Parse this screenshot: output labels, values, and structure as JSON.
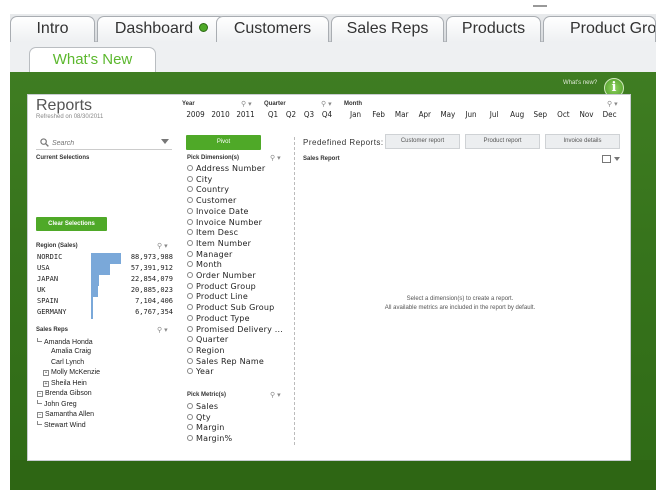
{
  "tabs": [
    {
      "label": "Intro"
    },
    {
      "label": "Dashboard"
    },
    {
      "label": "Customers"
    },
    {
      "label": "Sales Reps"
    },
    {
      "label": "Products"
    },
    {
      "label": "Product Grou"
    }
  ],
  "subtab": {
    "label": "What's New"
  },
  "help": {
    "whats_new_label": "What's new?",
    "info_glyph": "i"
  },
  "reports": {
    "title": "Reports",
    "refreshed": "Refreshed on 08/30/2011"
  },
  "filters": {
    "year_label": "Year",
    "years": [
      "2009",
      "2010",
      "2011"
    ],
    "quarter_label": "Quarter",
    "quarters": [
      "Q1",
      "Q2",
      "Q3",
      "Q4"
    ],
    "month_label": "Month",
    "months": [
      "Jan",
      "Feb",
      "Mar",
      "Apr",
      "May",
      "Jun",
      "Jul",
      "Aug",
      "Sep",
      "Oct",
      "Nov",
      "Dec"
    ]
  },
  "left": {
    "search_placeholder": "Search",
    "current_selections_label": "Current Selections",
    "clear_selections_label": "Clear Selections",
    "region_label": "Region (Sales)",
    "regions": [
      {
        "name": "NORDIC",
        "value": "88,973,988",
        "fraction": 1.0
      },
      {
        "name": "USA",
        "value": "57,391,912",
        "fraction": 0.645
      },
      {
        "name": "JAPAN",
        "value": "22,854,079",
        "fraction": 0.257
      },
      {
        "name": "UK",
        "value": "20,885,023",
        "fraction": 0.235
      },
      {
        "name": "SPAIN",
        "value": "7,104,406",
        "fraction": 0.08
      },
      {
        "name": "GERMANY",
        "value": "6,767,354",
        "fraction": 0.076
      }
    ],
    "sales_reps_label": "Sales Reps",
    "sales_reps": [
      {
        "name": "Amanda Honda",
        "marker": "tick"
      },
      {
        "name": "Amalia Craig",
        "marker": "none"
      },
      {
        "name": "Carl Lynch",
        "marker": "none"
      },
      {
        "name": "Molly McKenzie",
        "marker": "dot"
      },
      {
        "name": "Sheila Hein",
        "marker": "plus"
      },
      {
        "name": "Brenda Gibson",
        "marker": "box"
      },
      {
        "name": "John Greg",
        "marker": "tick"
      },
      {
        "name": "Samantha Allen",
        "marker": "box"
      },
      {
        "name": "Stewart Wind",
        "marker": "tick"
      }
    ]
  },
  "middle": {
    "pivot_label": "Pivot",
    "pick_dimension_label": "Pick Dimension(s)",
    "dimensions": [
      "Address Number",
      "City",
      "Country",
      "Customer",
      "Invoice Date",
      "Invoice Number",
      "Item Desc",
      "Item Number",
      "Manager",
      "Month",
      "Order Number",
      "Product Group",
      "Product Line",
      "Product Sub Group",
      "Product Type",
      "Promised Delivery ...",
      "Quarter",
      "Region",
      "Sales Rep Name",
      "Year"
    ],
    "pick_metric_label": "Pick Metric(s)",
    "metrics": [
      "Sales",
      "Qty",
      "Margin",
      "Margin%"
    ]
  },
  "right": {
    "predefined_label": "Predefined Reports:",
    "buttons": [
      "Customer report",
      "Product report",
      "Invoice details"
    ],
    "sales_report_label": "Sales Report",
    "hint_line1": "Select a dimension(s) to create a report.",
    "hint_line2": "All available metrics are included in the report by default."
  },
  "colors": {
    "accent_green": "#4fa928",
    "region_bar": "#7aa8d9",
    "tab_dot": "#4fa928"
  }
}
